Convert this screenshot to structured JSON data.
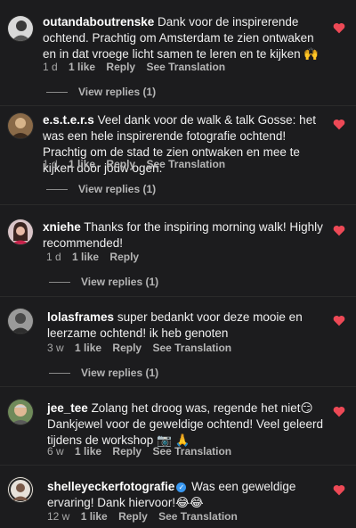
{
  "comments": [
    {
      "username": "outandaboutrenske",
      "text": "Dank voor de inspirerende ochtend. Prachtig om Amsterdam te zien ontwaken en in dat vroege licht samen te leren en te kijken 🙌",
      "time": "1 d",
      "likes": "1 like",
      "reply": "Reply",
      "translate": "See Translation",
      "view_replies": "View replies (1)",
      "avatar_icon": "avatar-icon"
    },
    {
      "username": "e.s.t.e.r.s",
      "text": "Veel dank voor de walk & talk Gosse: het was een hele inspirerende fotografie ochtend! Prachtig om de stad te zien ontwaken en mee te kijken door jouw ogen.",
      "time": "1 d",
      "likes": "1 like",
      "reply": "Reply",
      "translate": "See Translation",
      "view_replies": "View replies (1)",
      "avatar_icon": "avatar-icon"
    },
    {
      "username": "xniehe",
      "text": "Thanks for the inspiring morning walk! Highly recommended!",
      "time": "1 d",
      "likes": "1 like",
      "reply": "Reply",
      "view_replies": "View replies (1)",
      "avatar_icon": "avatar-icon"
    },
    {
      "username": "lolasframes",
      "text": "super bedankt voor deze mooie en leerzame ochtend! ik heb genoten",
      "time": "3 w",
      "likes": "1 like",
      "reply": "Reply",
      "translate": "See Translation",
      "view_replies": "View replies (1)",
      "avatar_icon": "avatar-icon"
    },
    {
      "username": "jee_tee",
      "text": "Zolang het droog was, regende het niet😏 Dankjewel voor de geweldige ochtend! Veel geleerd tijdens de workshop 📷 🙏",
      "time": "6 w",
      "likes": "1 like",
      "reply": "Reply",
      "translate": "See Translation",
      "avatar_icon": "avatar-icon"
    },
    {
      "username": "shelleyeckerfotografie",
      "verified": "✓",
      "text": "Was een geweldige ervaring! Dank hiervoor!😂😂",
      "time": "12 w",
      "likes": "1 like",
      "reply": "Reply",
      "translate": "See Translation",
      "avatar_icon": "avatar-icon"
    }
  ],
  "colors": {
    "background": "#1c1c1e",
    "heart": "#ed4956",
    "verified": "#3897f0"
  },
  "icons": {
    "like": "heart-icon",
    "verified": "verified-badge-icon"
  }
}
